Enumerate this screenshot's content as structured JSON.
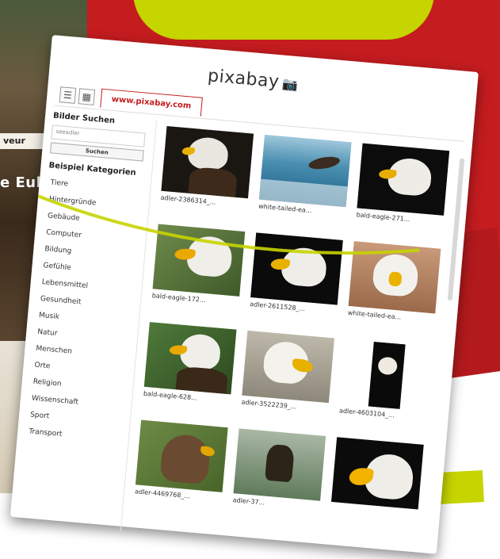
{
  "background": {
    "left_caption": "veur",
    "left_overlay_title": "e Eul"
  },
  "browser": {
    "logo_text": "pixabay",
    "url": "www.pixabay.com"
  },
  "sidebar": {
    "search_title": "Bilder Suchen",
    "search_value": "seeadler",
    "search_button": "Suchen",
    "categories_title": "Beispiel Kategorien",
    "categories": [
      "Tiere",
      "Hintergründe",
      "Gebäude",
      "Computer",
      "Bildung",
      "Gefühle",
      "Lebensmittel",
      "Gesundheit",
      "Musik",
      "Natur",
      "Menschen",
      "Orte",
      "Religion",
      "Wissenschaft",
      "Sport",
      "Transport"
    ]
  },
  "results": [
    {
      "label": "adler-2386314_..."
    },
    {
      "label": "white-tailed-ea..."
    },
    {
      "label": "bald-eagle-271..."
    },
    {
      "label": "bald-eagle-172..."
    },
    {
      "label": "adler-2611528_..."
    },
    {
      "label": "white-tailed-ea..."
    },
    {
      "label": "bald-eagle-628..."
    },
    {
      "label": "adler-3522239_..."
    },
    {
      "label": "adler-4603104_..."
    },
    {
      "label": "adler-4469768_..."
    },
    {
      "label": "adler-37..."
    },
    {
      "label": ""
    }
  ],
  "colors": {
    "brand_red": "#c41c1f",
    "accent_lime": "#c6d400"
  }
}
